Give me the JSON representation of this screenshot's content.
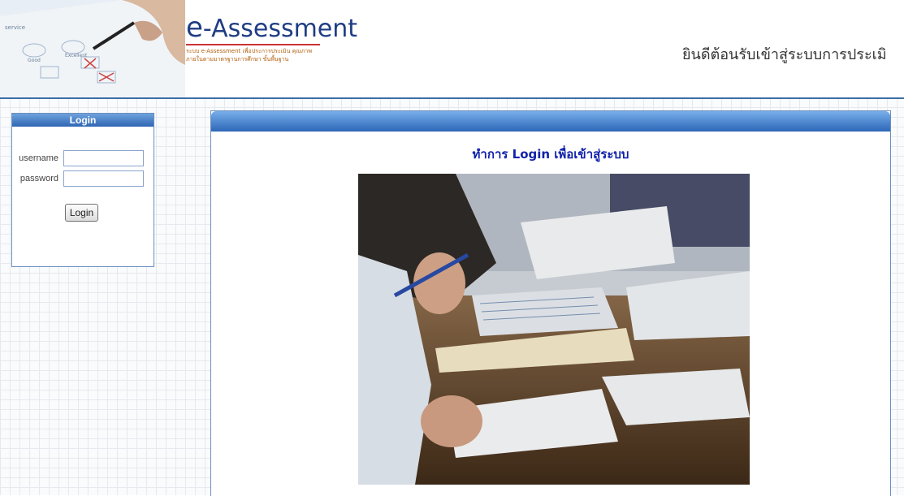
{
  "header": {
    "logo_title_e": "e",
    "logo_title_rest": "-Assessment",
    "logo_subtitle": "ระบบ e-Assessment เพื่อประการประเมิน คุณภาพภายในตามมาตรฐานการศึกษา ขั้นพื้นฐาน",
    "welcome_text": "ยินดีต้อนรับเข้าสู่ระบบการประเมิ"
  },
  "login": {
    "title": "Login",
    "username_label": "username",
    "username_value": "",
    "password_label": "password",
    "password_value": "",
    "button_label": "Login"
  },
  "main": {
    "title": "ทำการ Login เพื่อเข้าสู่ระบบ"
  }
}
